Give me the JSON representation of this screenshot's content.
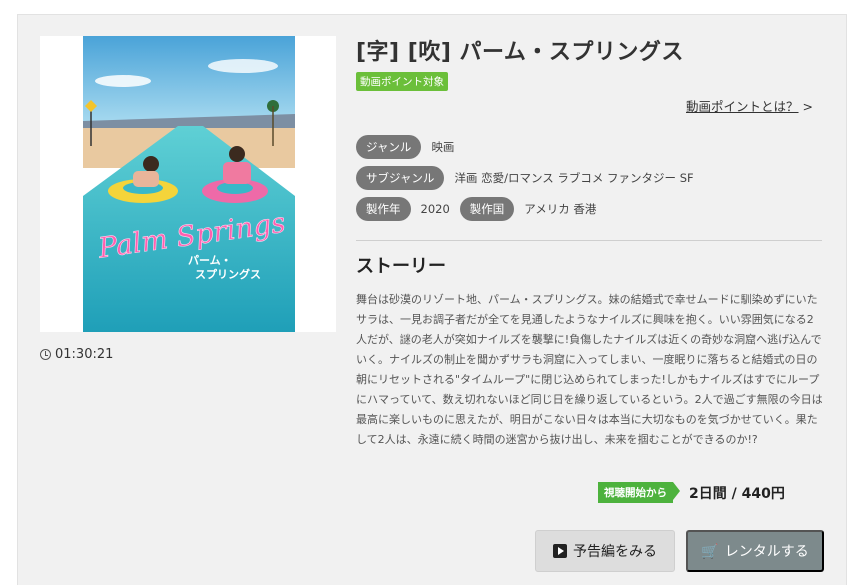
{
  "movie": {
    "title": "[字] [吹] パーム・スプリングス",
    "point_badge": "動画ポイント対象",
    "point_link": "動画ポイントとは？",
    "point_link_arrow": ">",
    "duration": "01:30:21",
    "poster_alt": "Palm Springs poster",
    "poster_title_en": "Palm Springs",
    "poster_title_jp_line1": "パーム・",
    "poster_title_jp_line2": "スプリングス"
  },
  "meta": {
    "genre_label": "ジャンル",
    "genre_value": "映画",
    "subgenre_label": "サブジャンル",
    "subgenre_value": "洋画 恋愛/ロマンス ラブコメ ファンタジー SF",
    "year_label": "製作年",
    "year_value": "2020",
    "country_label": "製作国",
    "country_value": "アメリカ 香港"
  },
  "story": {
    "heading": "ストーリー",
    "text": "舞台は砂漠のリゾート地、パーム・スプリングス。妹の結婚式で幸せムードに馴染めずにいたサラは、一見お調子者だが全てを見通したようなナイルズに興味を抱く。いい雰囲気になる2人だが、謎の老人が突如ナイルズを襲撃に!負傷したナイルズは近くの奇妙な洞窟へ逃げ込んでいく。ナイルズの制止を聞かずサラも洞窟に入ってしまい、一度眠りに落ちると結婚式の日の朝にリセットされる\"タイムループ\"に閉じ込められてしまった!しかもナイルズはすでにループにハマっていて、数え切れないほど同じ日を繰り返しているという。2人で過ごす無限の今日は最高に楽しいものに思えたが、明日がこない日々は本当に大切なものを気づかせていく。果たして2人は、永遠に続く時間の迷宮から抜け出し、未来を掴むことができるのか!?"
  },
  "rental": {
    "start_badge": "視聴開始から",
    "price": "2日間 / 440円",
    "trailer_button": "予告編をみる",
    "rent_button": "レンタルする",
    "cart_symbol": "🛒"
  },
  "colors": {
    "accent_green": "#6bbf3a",
    "tag_gray": "#777777",
    "rent_button": "#7d8a8c"
  }
}
